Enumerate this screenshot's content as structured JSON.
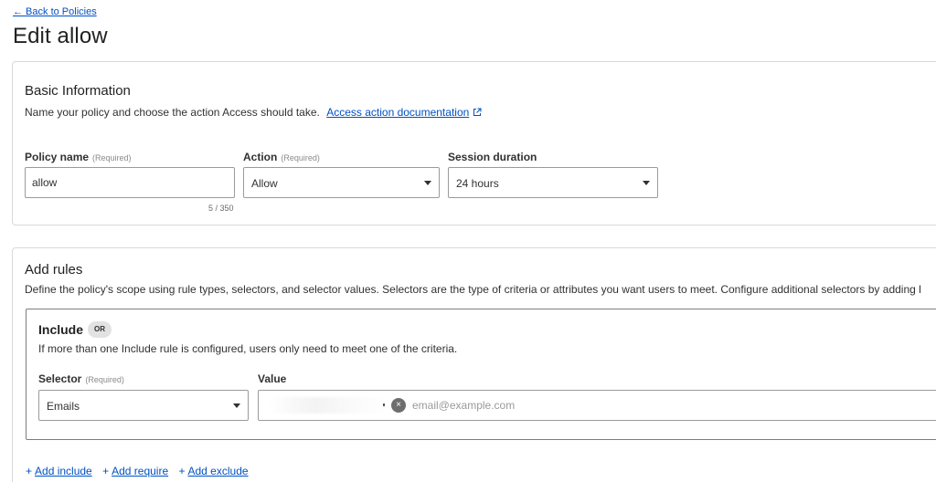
{
  "header": {
    "back_link": "← Back to Policies",
    "title": "Edit allow"
  },
  "basic": {
    "title": "Basic Information",
    "description": "Name your policy and choose the action Access should take.",
    "doc_link": "Access action documentation",
    "policy_name_label": "Policy name",
    "policy_name_required": "(Required)",
    "policy_name_value": "allow",
    "policy_name_counter": "5 / 350",
    "action_label": "Action",
    "action_required": "(Required)",
    "action_value": "Allow",
    "session_label": "Session duration",
    "session_value": "24 hours"
  },
  "rules": {
    "title": "Add rules",
    "description": "Define the policy's scope using rule types, selectors, and selector values. Selectors are the type of criteria or attributes you want users to meet. Configure additional selectors by adding l",
    "include_title": "Include",
    "or_badge": "OR",
    "include_desc": "If more than one Include rule is configured, users only need to meet one of the criteria.",
    "selector_label": "Selector",
    "selector_required": "(Required)",
    "selector_value": "Emails",
    "value_label": "Value",
    "value_placeholder": "email@example.com",
    "chip_remove_glyph": "×"
  },
  "actions": {
    "plus": "+",
    "add_include": "Add include",
    "add_require": "Add require",
    "add_exclude": "Add exclude"
  },
  "colors": {
    "link": "#0051c3",
    "text": "#313131",
    "border": "#d9d9d9"
  }
}
